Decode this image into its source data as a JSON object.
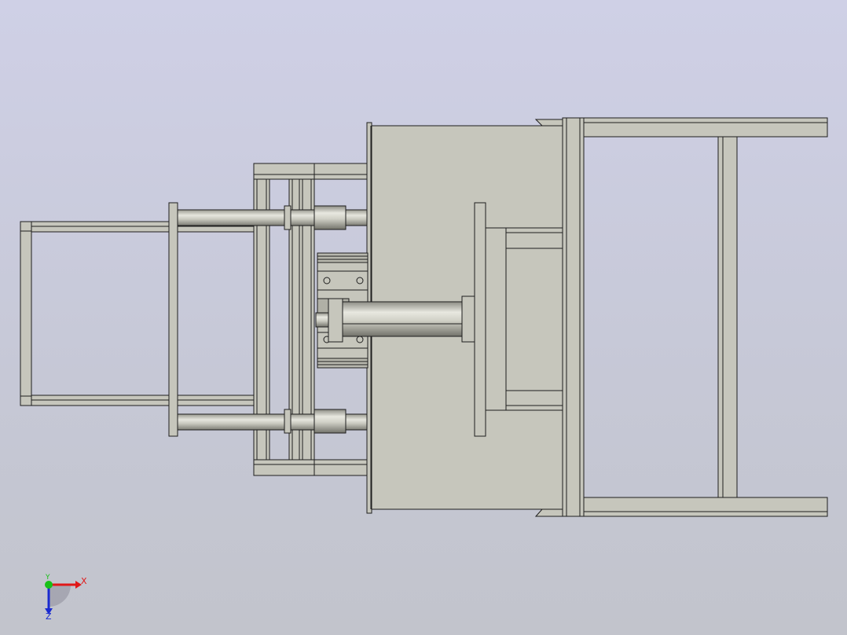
{
  "viewport": {
    "name": "graphics-area",
    "background_top": "#cfd0e6",
    "background_bottom": "#c2c4cc"
  },
  "model": {
    "fill": "#c6c6bc",
    "edge": "#1e1e1e",
    "shaft_highlight": "#e4e4dc"
  },
  "triad": {
    "x_label": "X",
    "y_label": "Y",
    "z_label": "Z",
    "x_color": "#e01818",
    "y_color": "#18c018",
    "z_color": "#1a2ad0"
  }
}
